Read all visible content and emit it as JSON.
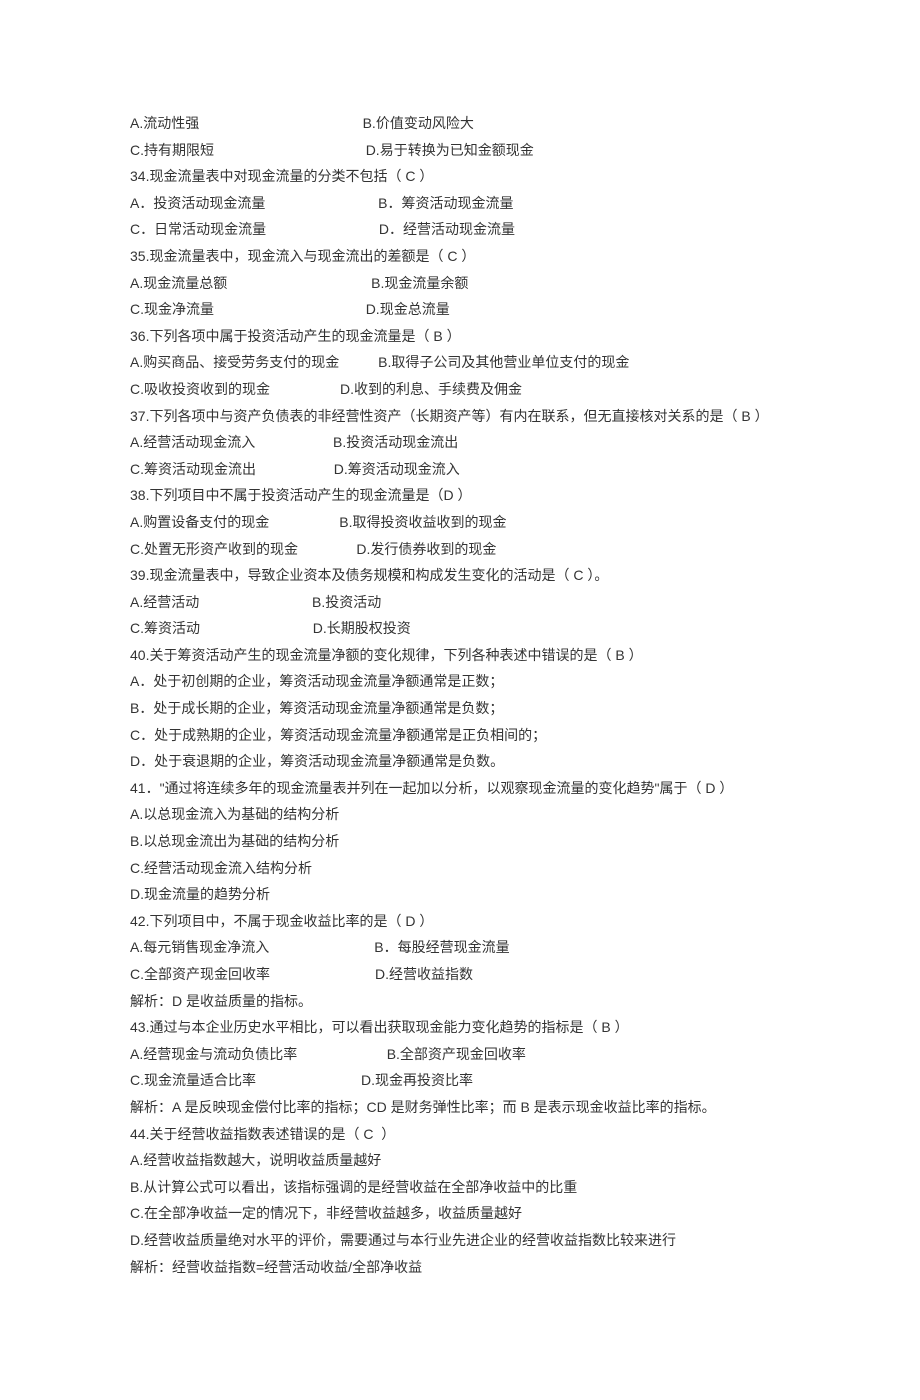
{
  "questions": [
    {
      "lines": [
        "A.流动性强                                          B.价值变动风险大",
        "C.持有期限短                                       D.易于转换为已知金额现金"
      ]
    },
    {
      "lines": [
        "34.现金流量表中对现金流量的分类不包括（ C ）",
        "A．投资活动现金流量                             B．筹资活动现金流量",
        "C．日常活动现金流量                             D．经营活动现金流量"
      ]
    },
    {
      "lines": [
        "35.现金流量表中，现金流入与现金流出的差额是（ C ）",
        "A.现金流量总额                                     B.现金流量余额",
        "C.现金净流量                                       D.现金总流量"
      ]
    },
    {
      "lines": [
        "36.下列各项中属于投资活动产生的现金流量是（ B ）",
        "A.购买商品、接受劳务支付的现金          B.取得子公司及其他营业单位支付的现金",
        "C.吸收投资收到的现金                  D.收到的利息、手续费及佣金"
      ]
    },
    {
      "lines": [
        "37.下列各项中与资产负债表的非经营性资产（长期资产等）有内在联系，但无直接核对关系的是（ B ）",
        "A.经营活动现金流入                    B.投资活动现金流出",
        "C.筹资活动现金流出                    D.筹资活动现金流入"
      ]
    },
    {
      "lines": [
        "38.下列项目中不属于投资活动产生的现金流量是（D ）",
        "A.购置设备支付的现金                  B.取得投资收益收到的现金",
        "C.处置无形资产收到的现金               D.发行债券收到的现金"
      ]
    },
    {
      "lines": [
        "39.现金流量表中，导致企业资本及债务规模和构成发生变化的活动是（ C ）。",
        "A.经营活动                             B.投资活动",
        "C.筹资活动                             D.长期股权投资"
      ]
    },
    {
      "lines": [
        "40.关于筹资活动产生的现金流量净额的变化规律，下列各种表述中错误的是（ B ）",
        "A．处于初创期的企业，筹资活动现金流量净额通常是正数；",
        "B．处于成长期的企业，筹资活动现金流量净额通常是负数；",
        "C．处于成熟期的企业，筹资活动现金流量净额通常是正负相间的；",
        "D．处于衰退期的企业，筹资活动现金流量净额通常是负数。"
      ]
    },
    {
      "lines": [
        "41．\"通过将连续多年的现金流量表并列在一起加以分析，以观察现金流量的变化趋势\"属于（ D ）",
        "A.以总现金流入为基础的结构分析",
        "B.以总现金流出为基础的结构分析",
        "C.经营活动现金流入结构分析",
        "D.现金流量的趋势分析"
      ]
    },
    {
      "lines": [
        "42.下列项目中，不属于现金收益比率的是（ D ）",
        "A.每元销售现金净流入                           B．每股经营现金流量",
        "C.全部资产现金回收率                           D.经营收益指数",
        "解析：D 是收益质量的指标。"
      ]
    },
    {
      "lines": [
        "43.通过与本企业历史水平相比，可以看出获取现金能力变化趋势的指标是（ B ）",
        "A.经营现金与流动负债比率                       B.全部资产现金回收率",
        "C.现金流量适合比率                           D.现金再投资比率",
        "解析：A 是反映现金偿付比率的指标；CD 是财务弹性比率；而 B 是表示现金收益比率的指标。"
      ]
    },
    {
      "lines": [
        "44.关于经营收益指数表述错误的是（ C  ）",
        "A.经营收益指数越大，说明收益质量越好",
        "B.从计算公式可以看出，该指标强调的是经营收益在全部净收益中的比重",
        "C.在全部净收益一定的情况下，非经营收益越多，收益质量越好",
        "D.经营收益质量绝对水平的评价，需要通过与本行业先进企业的经营收益指数比较来进行",
        "解析：经营收益指数=经营活动收益/全部净收益"
      ]
    }
  ]
}
